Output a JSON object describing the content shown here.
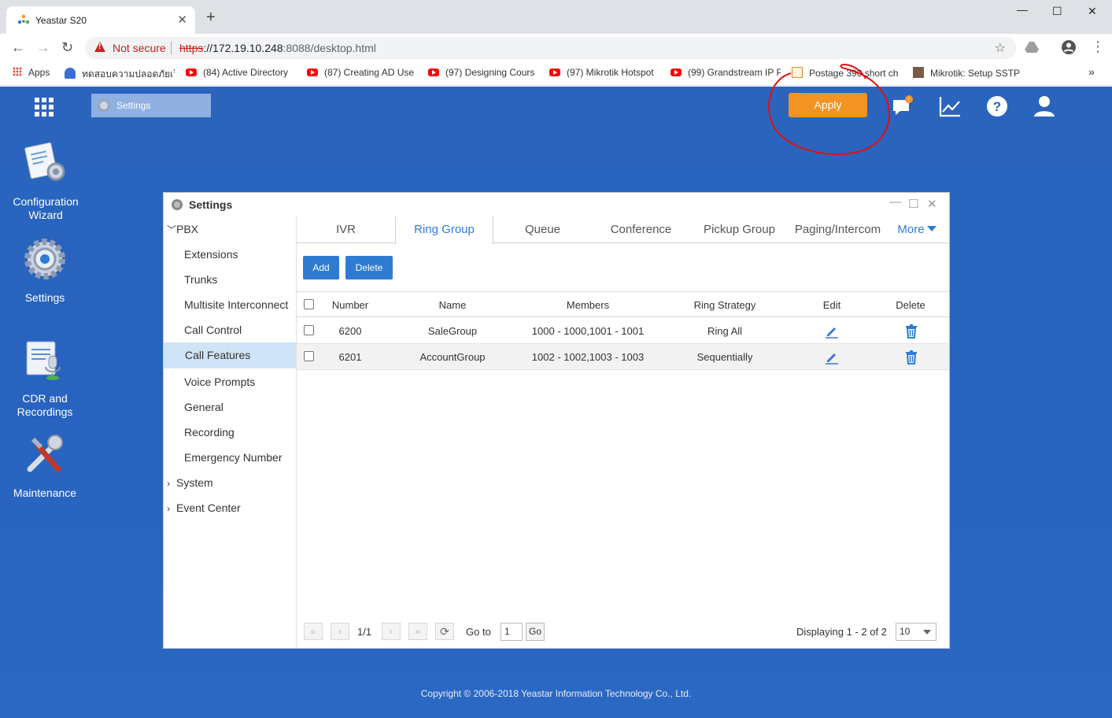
{
  "browser": {
    "tab_title": "Yeastar S20",
    "new_tab": "+",
    "security_label": "Not secure",
    "url_scheme": "https",
    "url_host": "://172.19.10.248",
    "url_rest": ":8088/desktop.html",
    "window_controls": {
      "minimize": "—",
      "maximize": "☐",
      "close": "✕"
    },
    "bookmarks": [
      "Apps",
      "ทดสอบความปลอดภัยเว็บ",
      "(84) Active Directory",
      "(87) Creating AD Use",
      "(97) Designing Cours",
      "(97) Mikrotik Hotspot",
      "(99) Grandstream IP P",
      "Postage 390 short ch",
      "Mikrotik: Setup SSTP"
    ],
    "bookmarks_overflow": "»"
  },
  "desktop": {
    "task_button": "Settings",
    "apply_button": "Apply",
    "accent_color": "#f39321",
    "icons": [
      {
        "name": "configuration-wizard",
        "label_line1": "Configuration",
        "label_line2": "Wizard"
      },
      {
        "name": "settings",
        "label_line1": "Settings",
        "label_line2": ""
      },
      {
        "name": "cdr-and-recordings",
        "label_line1": "CDR and",
        "label_line2": "Recordings"
      },
      {
        "name": "maintenance",
        "label_line1": "Maintenance",
        "label_line2": ""
      }
    ],
    "copyright": "Copyright © 2006-2018 Yeastar Information Technology Co., Ltd."
  },
  "window": {
    "title": "Settings",
    "sidebar": {
      "pbx": "PBX",
      "items": [
        "Extensions",
        "Trunks",
        "Multisite Interconnect",
        "Call Control",
        "Call Features",
        "Voice Prompts",
        "General",
        "Recording",
        "Emergency Number"
      ],
      "active_item": "Call Features",
      "system": "System",
      "event_center": "Event Center"
    },
    "tabs": [
      "IVR",
      "Ring Group",
      "Queue",
      "Conference",
      "Pickup Group",
      "Paging/Intercom"
    ],
    "active_tab": "Ring Group",
    "more_tab": "More",
    "add_button": "Add",
    "delete_button": "Delete",
    "table": {
      "headers": {
        "number": "Number",
        "name": "Name",
        "members": "Members",
        "strategy": "Ring Strategy",
        "edit": "Edit",
        "delete": "Delete"
      },
      "rows": [
        {
          "number": "6200",
          "name": "SaleGroup",
          "members": "1000 - 1000,1001 - 1001",
          "strategy": "Ring All"
        },
        {
          "number": "6201",
          "name": "AccountGroup",
          "members": "1002 - 1002,1003 - 1003",
          "strategy": "Sequentially"
        }
      ]
    },
    "pager": {
      "first": "«",
      "prev": "‹",
      "page": "1/1",
      "next": "›",
      "last": "»",
      "refresh": "⟳",
      "goto_label": "Go to",
      "goto_value": "1",
      "go_button": "Go",
      "displaying": "Displaying 1 - 2 of 2",
      "page_size": "10"
    }
  }
}
